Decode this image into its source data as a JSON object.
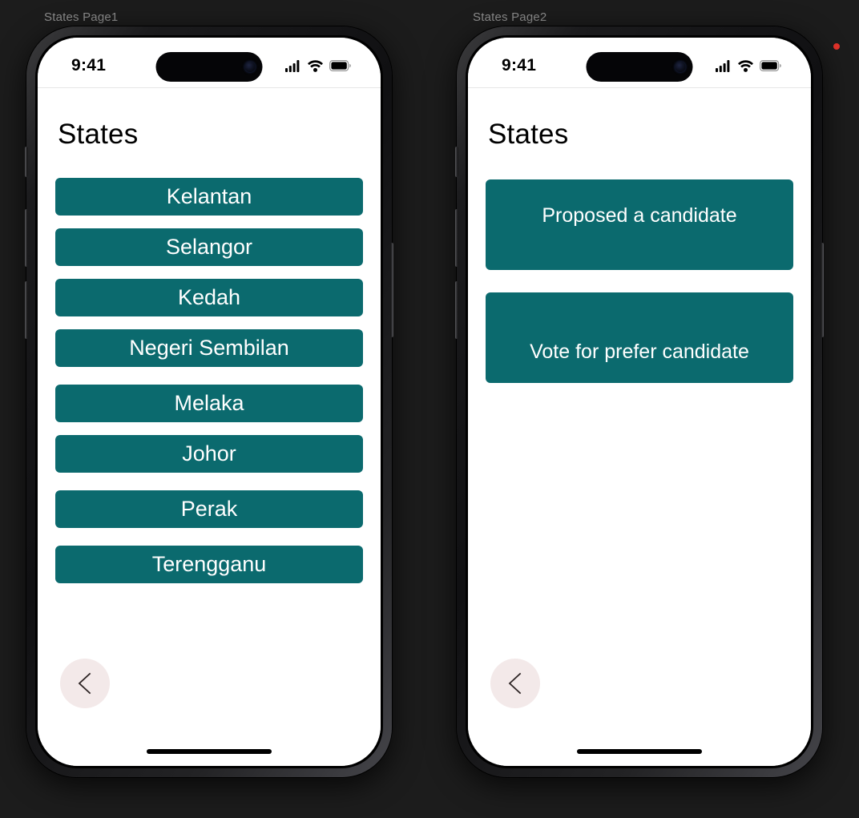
{
  "canvas": {
    "background_color": "#1c1c1c",
    "accent_color": "#0b6a6e",
    "back_button_color": "#f3e9e9",
    "marker_dot_color": "#e2322a"
  },
  "frames": [
    {
      "caption": "States Page1",
      "status_bar": {
        "time": "9:41",
        "cellular_icon": "cellular-bars-icon",
        "wifi_icon": "wifi-icon",
        "battery_icon": "battery-full-icon"
      },
      "page_title": "States",
      "buttons": [
        {
          "label": "Kelantan"
        },
        {
          "label": "Selangor"
        },
        {
          "label": "Kedah"
        },
        {
          "label": "Negeri Sembilan"
        },
        {
          "label": "Melaka"
        },
        {
          "label": "Johor"
        },
        {
          "label": "Perak"
        },
        {
          "label": "Terengganu"
        }
      ],
      "back_button": {
        "icon": "chevron-left-icon"
      }
    },
    {
      "caption": "States Page2",
      "status_bar": {
        "time": "9:41",
        "cellular_icon": "cellular-bars-icon",
        "wifi_icon": "wifi-icon",
        "battery_icon": "battery-full-icon"
      },
      "page_title": "States",
      "buttons": [
        {
          "label": "Proposed a candidate"
        },
        {
          "label": "Vote for prefer candidate"
        }
      ],
      "back_button": {
        "icon": "chevron-left-icon"
      }
    }
  ]
}
